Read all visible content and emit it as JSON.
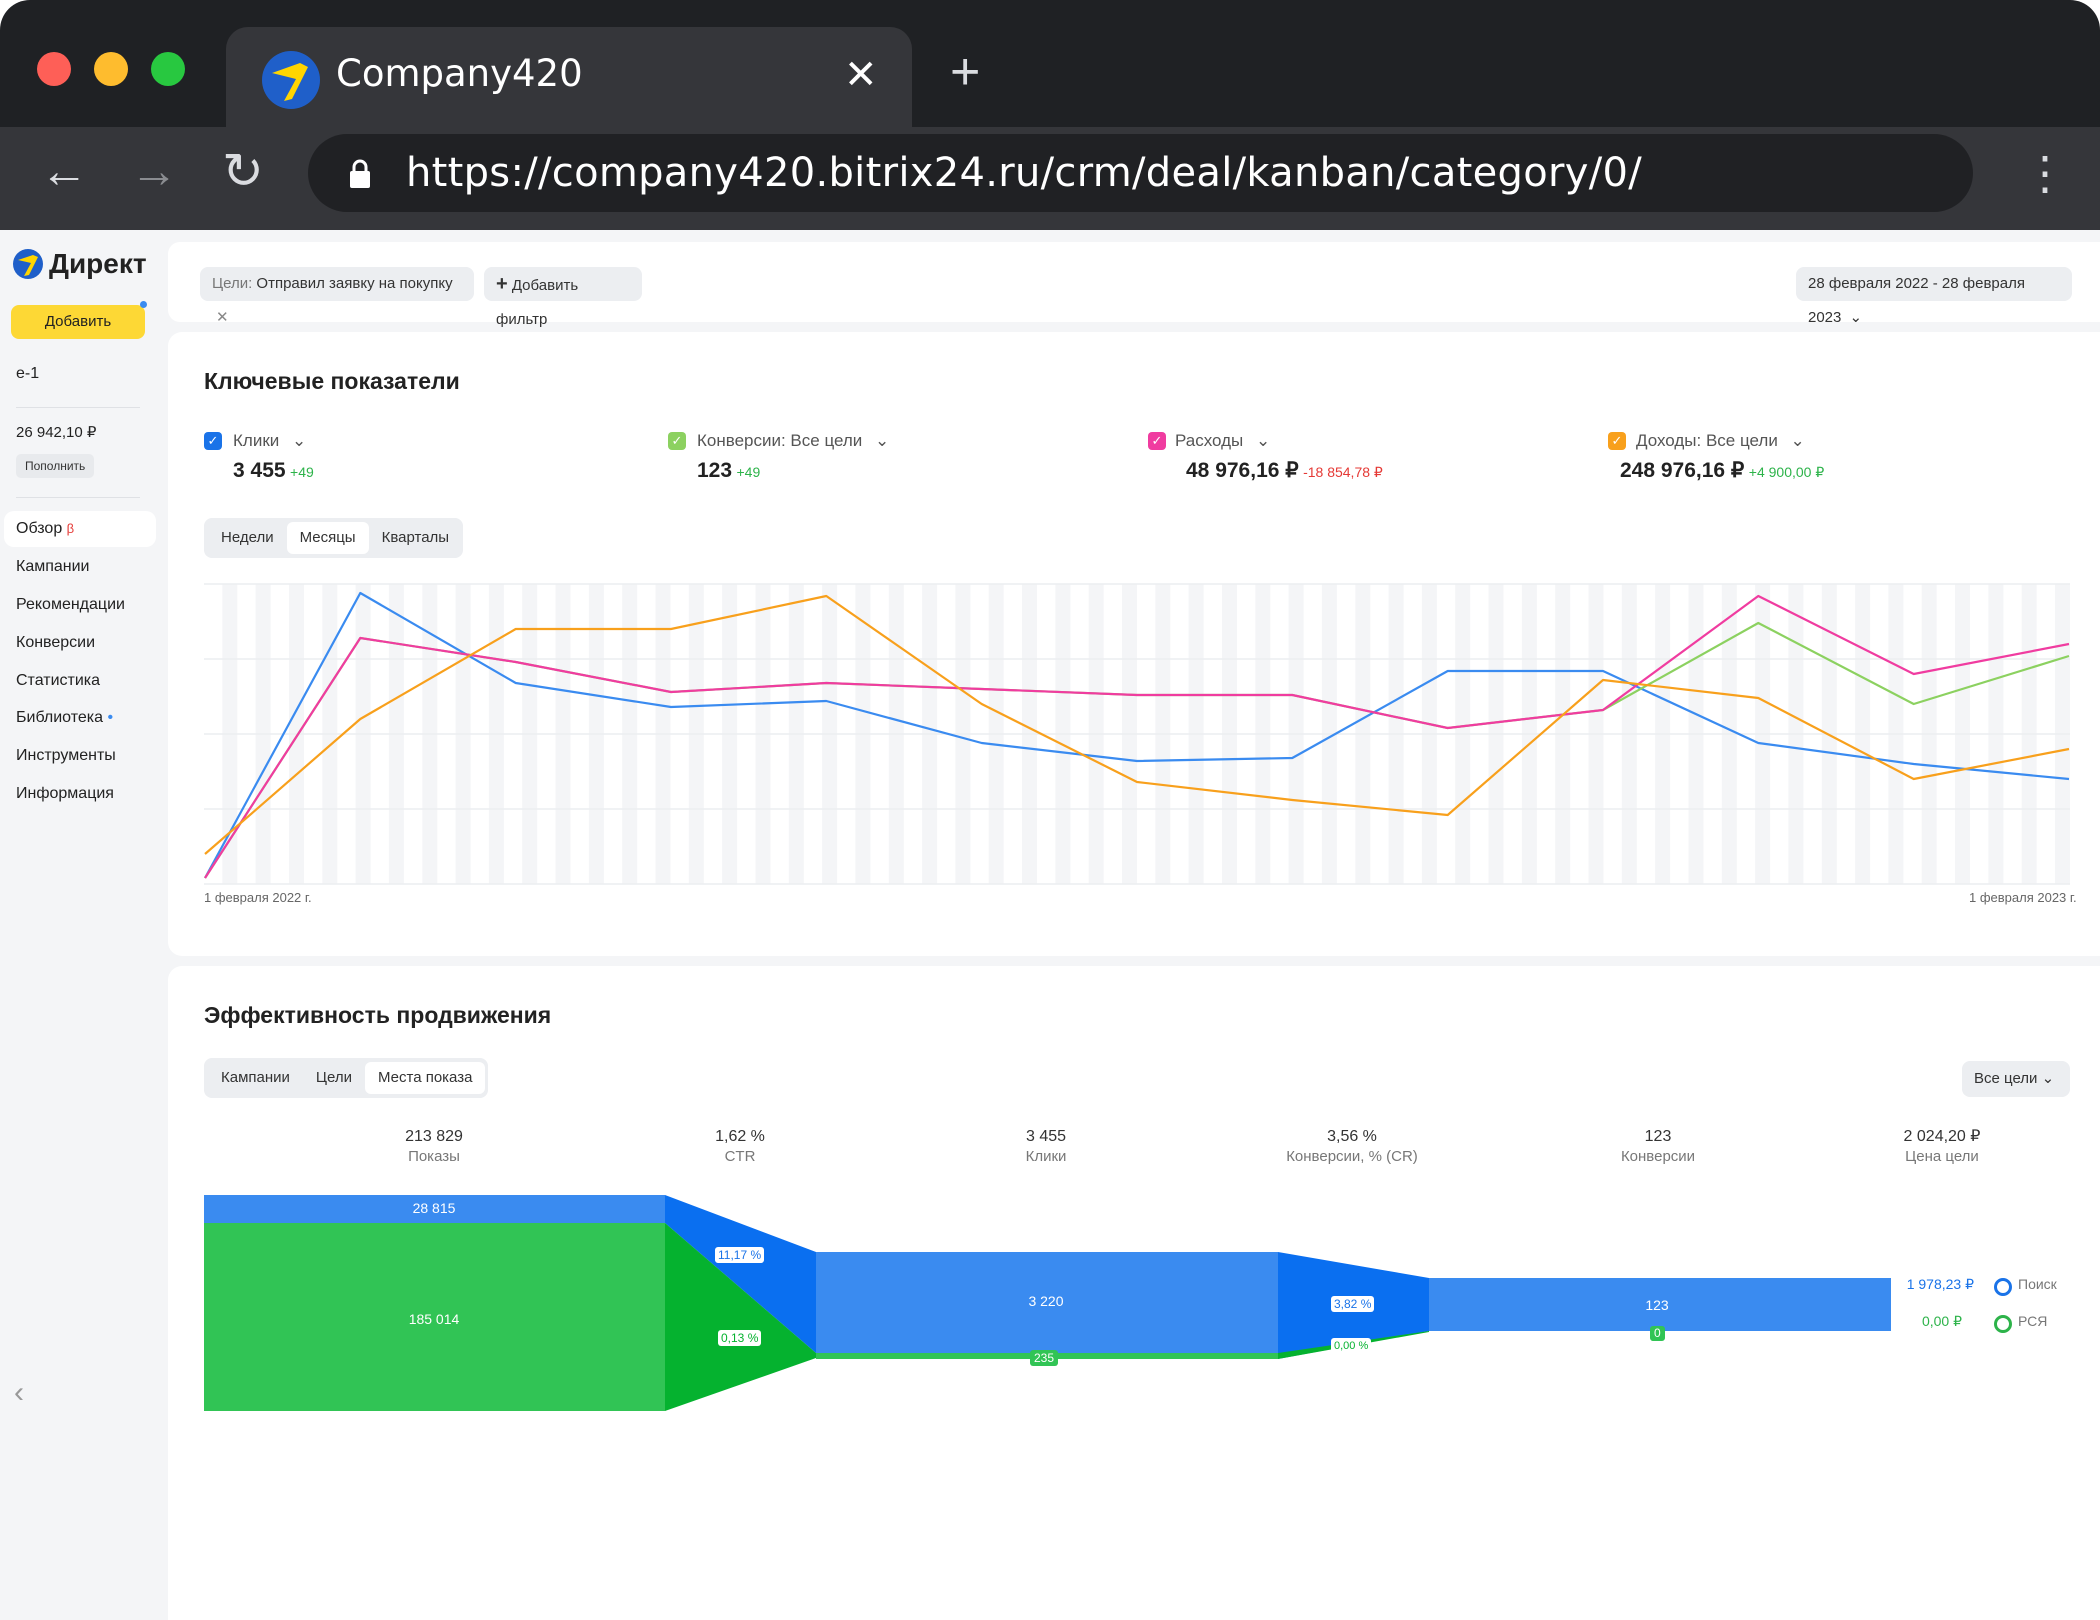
{
  "browser": {
    "tab_title": "Company420",
    "url": "https://company420.bitrix24.ru/crm/deal/kanban/category/0/",
    "tab_close": "✕",
    "new_tab": "+",
    "back": "←",
    "forward": "→",
    "reload": "↻",
    "menu": "⋮"
  },
  "sidebar": {
    "logo": "Директ",
    "add_button": "Добавить",
    "account": "e-1",
    "balance": "26 942,10 ₽",
    "topup": "Пополнить",
    "items": [
      {
        "label": "Обзор",
        "badge": "β",
        "active": true
      },
      {
        "label": "Кампании"
      },
      {
        "label": "Рекомендации"
      },
      {
        "label": "Конверсии"
      },
      {
        "label": "Статистика"
      },
      {
        "label": "Библиотека",
        "dot": "•"
      },
      {
        "label": "Инструменты"
      },
      {
        "label": "Информация"
      }
    ],
    "collapse": "‹"
  },
  "filters": {
    "goal_prefix": "Цели:",
    "goal_value": "Отправил заявку на покупку",
    "goal_remove": "✕",
    "add_filter": "Добавить фильтр",
    "add_icon": "+",
    "date_range": "28 февраля 2022 - 28 февраля 2023"
  },
  "key_metrics": {
    "title": "Ключевые показатели",
    "metrics": [
      {
        "label": "Клики",
        "value": "3 455",
        "delta": "+49",
        "color": "#1a73e8",
        "delta_color": "#2db34a"
      },
      {
        "label": "Конверсии: Все цели",
        "value": "123",
        "delta": "+49",
        "color": "#8cd160",
        "delta_color": "#2db34a"
      },
      {
        "label": "Расходы",
        "value": "48 976,16 ₽",
        "delta": "-18 854,78 ₽",
        "color": "#f03ca0",
        "delta_color": "#e53935"
      },
      {
        "label": "Доходы: Все цели",
        "value": "248 976,16 ₽",
        "delta": "+4 900,00 ₽",
        "color": "#f8a01c",
        "delta_color": "#2db34a"
      }
    ],
    "periods": [
      "Недели",
      "Месяцы",
      "Кварталы"
    ],
    "active_period": "Месяцы",
    "x_start": "1 февраля 2022 г.",
    "x_end": "1 февраля 2023 г."
  },
  "chart_data": {
    "type": "line",
    "x": [
      "1 февраля 2022 г.",
      "",
      "",
      "",
      "",
      "",
      "",
      "",
      "",
      "",
      "",
      "",
      "1 февраля 2023 г."
    ],
    "series": [
      {
        "name": "Клики",
        "color": "#3a8bf0",
        "values": [
          2,
          97,
          67,
          59,
          61,
          47,
          41,
          42,
          71,
          71,
          47,
          40,
          35
        ]
      },
      {
        "name": "Конверсии: Все цели",
        "color": "#8cd160",
        "values": [
          2,
          82,
          74,
          64,
          67,
          65,
          63,
          63,
          52,
          58,
          87,
          60,
          76
        ]
      },
      {
        "name": "Расходы",
        "color": "#f03ca0",
        "values": [
          2,
          82,
          74,
          64,
          67,
          65,
          63,
          63,
          52,
          58,
          96,
          70,
          80
        ]
      },
      {
        "name": "Доходы: Все цели",
        "color": "#f8a01c",
        "values": [
          10,
          55,
          85,
          85,
          96,
          60,
          34,
          28,
          23,
          68,
          62,
          35,
          45
        ]
      }
    ],
    "ylim": [
      0,
      100
    ],
    "grid": true
  },
  "effectiveness": {
    "title": "Эффективность продвижения",
    "tabs": [
      "Кампании",
      "Цели",
      "Места показа"
    ],
    "active_tab": "Места показа",
    "goals_select": "Все цели",
    "columns": [
      {
        "value": "213 829",
        "label": "Показы"
      },
      {
        "value": "1,62 %",
        "label": "CTR"
      },
      {
        "value": "3 455",
        "label": "Клики"
      },
      {
        "value": "3,56 %",
        "label": "Конверсии, % (CR)"
      },
      {
        "value": "123",
        "label": "Конверсии"
      },
      {
        "value": "2 024,20 ₽",
        "label": "Цена цели"
      }
    ],
    "funnel": {
      "search_shows": "28 815",
      "network_shows": "185 014",
      "search_ctr": "11,17 %",
      "network_ctr": "0,13 %",
      "search_clicks": "3 220",
      "network_clicks": "235",
      "search_cr": "3,82 %",
      "network_cr": "0,00 %",
      "search_conv": "123",
      "network_conv": "0"
    },
    "legend": [
      {
        "price": "1 978,23 ₽",
        "name": "Поиск",
        "color": "#1a73e8"
      },
      {
        "price": "0,00 ₽",
        "name": "РСЯ",
        "color": "#2db34a"
      }
    ]
  }
}
